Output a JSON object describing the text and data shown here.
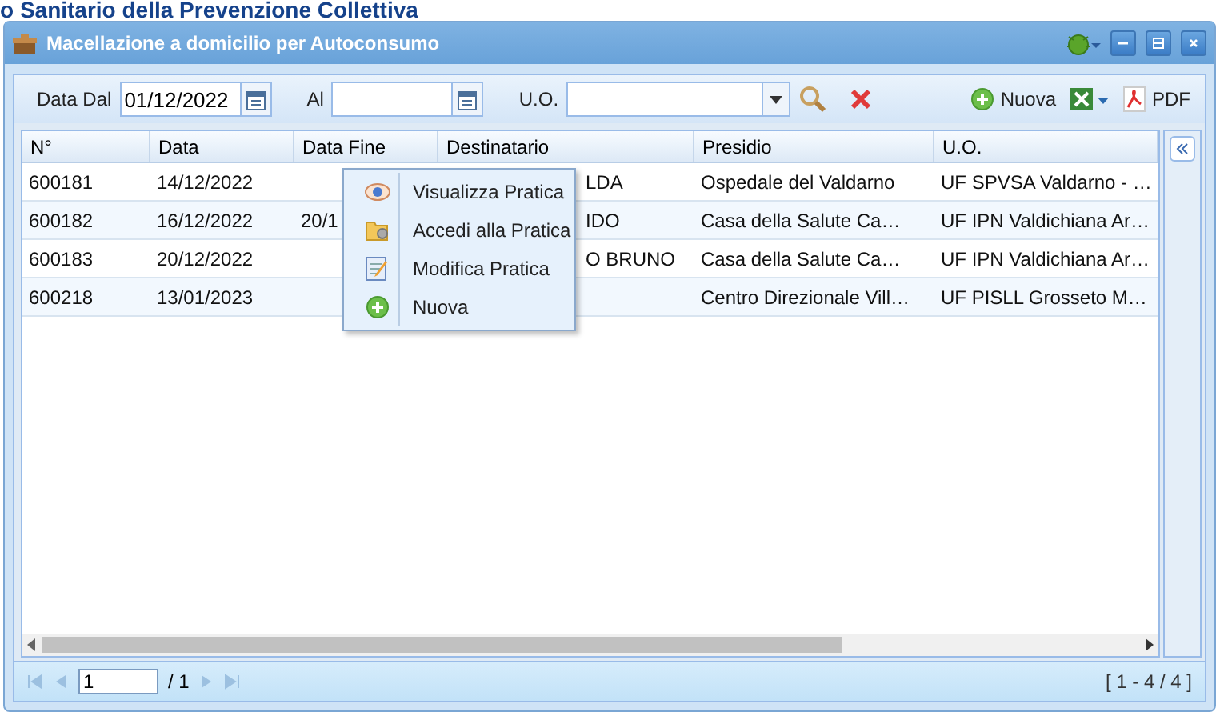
{
  "background_title": "o Sanitario della Prevenzione Collettiva",
  "window": {
    "title": "Macellazione a domicilio per Autoconsumo"
  },
  "filters": {
    "from_label": "Data Dal",
    "from_value": "01/12/2022",
    "to_label": "Al",
    "uo_label": "U.O."
  },
  "toolbar": {
    "new_label": "Nuova",
    "pdf_label": "PDF"
  },
  "table": {
    "columns": [
      "N°",
      "Data",
      "Data Fine",
      "Destinatario",
      "Presidio",
      "U.O."
    ],
    "rows": [
      {
        "cells": [
          "600181",
          "14/12/2022",
          "",
          "LDA",
          "Ospedale del Valdarno",
          "UF SPVSA Valdarno - …"
        ],
        "selected": false
      },
      {
        "cells": [
          "600182",
          "16/12/2022",
          "20/1",
          "IDO",
          "Casa della Salute Ca…",
          "UF IPN Valdichiana Ar…"
        ],
        "selected": false
      },
      {
        "cells": [
          "600183",
          "20/12/2022",
          "",
          "O BRUNO",
          "Casa della Salute Ca…",
          "UF IPN Valdichiana Ar…"
        ],
        "selected": false
      },
      {
        "cells": [
          "600218",
          "13/01/2023",
          "",
          "",
          "Centro Direzionale Vill…",
          "UF PISLL Grosseto M…"
        ],
        "selected": false
      }
    ]
  },
  "context_menu": [
    {
      "label": "Visualizza Pratica",
      "kind": "view"
    },
    {
      "label": "Accedi alla Pratica",
      "kind": "open"
    },
    {
      "label": "Modifica Pratica",
      "kind": "edit"
    },
    {
      "label": "Nuova",
      "kind": "new"
    }
  ],
  "paging": {
    "page": "1",
    "of": "/ 1",
    "summary": "[ 1 - 4 / 4 ]"
  }
}
